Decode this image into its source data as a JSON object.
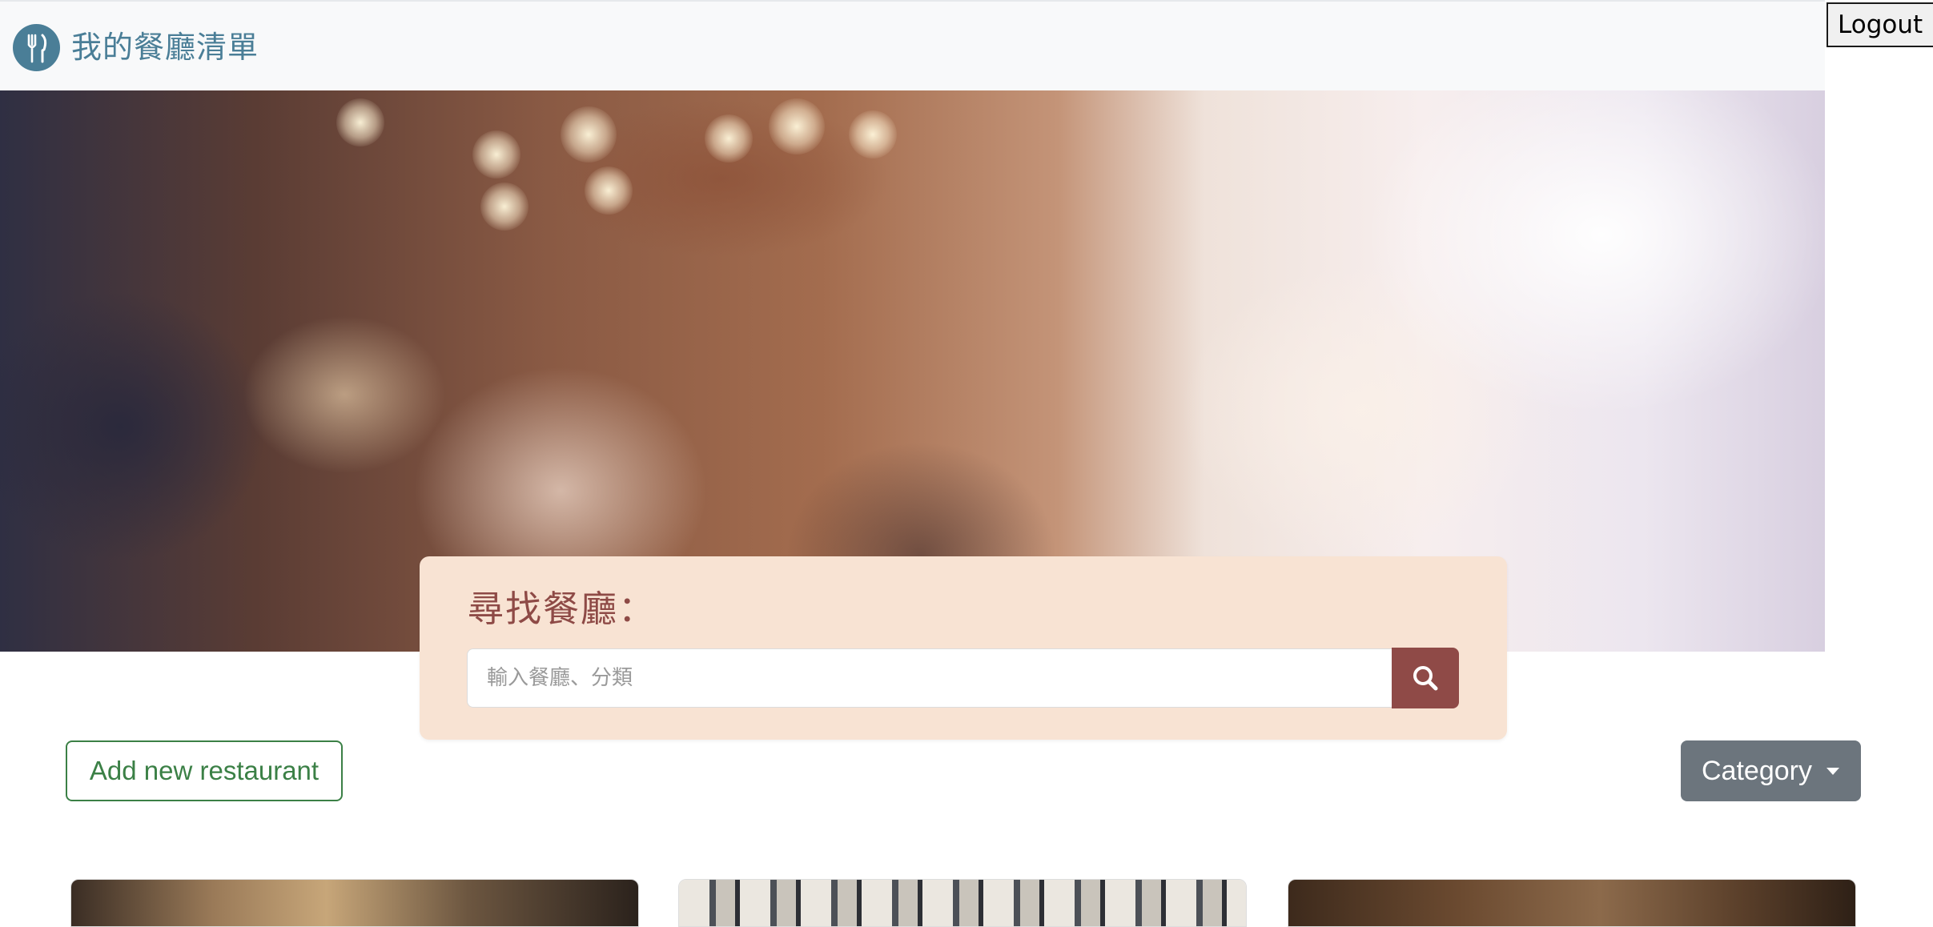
{
  "navbar": {
    "brand_icon": "utensils-icon",
    "brand_title": "我的餐廳清單",
    "logout_label": "Logout"
  },
  "hero": {
    "image": "blurred-restaurant-interior"
  },
  "search": {
    "title": "尋找餐廳：",
    "placeholder": "輸入餐廳、分類",
    "value": "",
    "button_icon": "search-icon"
  },
  "actions": {
    "add_label": "Add new restaurant",
    "category_label": "Category",
    "category_icon": "caret-down-icon"
  },
  "colors": {
    "brand": "#4a7e97",
    "search_card_bg": "#f8e3d3",
    "search_accent": "#8f4a47",
    "add_button": "#3b8046",
    "category_button": "#6c757d"
  },
  "restaurants": [
    {
      "image": "restaurant-photo-1"
    },
    {
      "image": "restaurant-photo-2"
    },
    {
      "image": "restaurant-photo-3"
    }
  ]
}
